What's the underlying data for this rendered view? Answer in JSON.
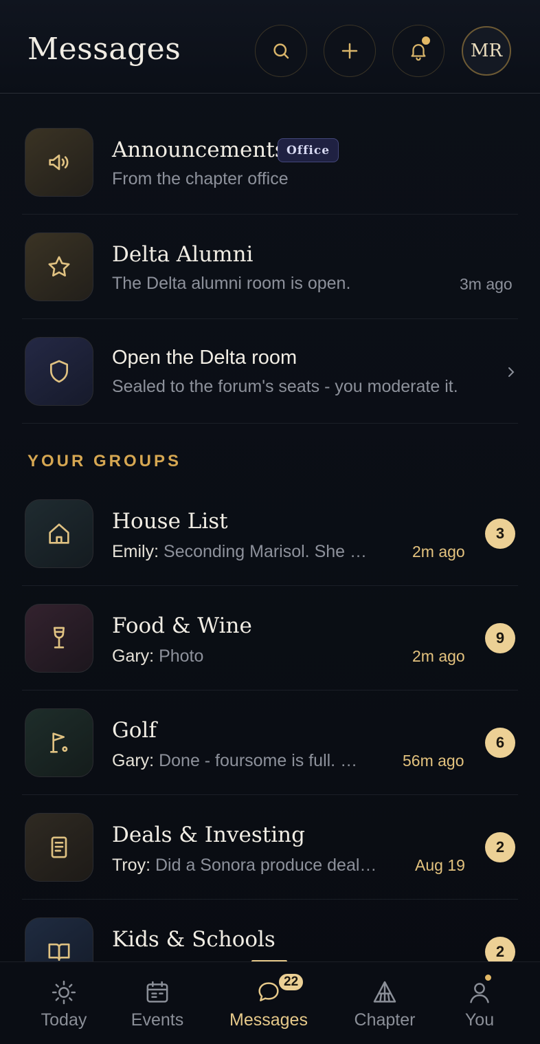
{
  "header": {
    "title": "Messages",
    "avatar_initials": "MR",
    "accent": "#e2b866"
  },
  "pinned": [
    {
      "title": "Announcements",
      "chip": "Office",
      "subtitle": "From the chapter office",
      "time": "",
      "icon": "megaphone-icon"
    },
    {
      "title": "Delta Alumni",
      "subtitle": "The Delta alumni room is open.",
      "time": "3m ago",
      "icon": "star-icon"
    },
    {
      "title": "Open the Delta room",
      "subtitle": "Sealed to the forum's seats - you moderate it.",
      "icon": "shield-icon"
    }
  ],
  "section_label": "YOUR GROUPS",
  "groups": [
    {
      "title": "House List",
      "sender": "Emily:",
      "preview": "Seconding Marisol. She …",
      "time": "2m ago",
      "unread": "3",
      "icon": "home-icon"
    },
    {
      "title": "Food & Wine",
      "sender": "Gary:",
      "preview": "Photo",
      "time": "2m ago",
      "unread": "9",
      "icon": "wine-glass-icon"
    },
    {
      "title": "Golf",
      "sender": "Gary:",
      "preview": "Done - foursome is full. …",
      "time": "56m ago",
      "unread": "6",
      "icon": "golf-flag-icon"
    },
    {
      "title": "Deals & Investing",
      "sender": "Troy:",
      "preview": "Did a Sonora produce deal…",
      "time": "Aug 19",
      "unread": "2",
      "icon": "document-icon"
    },
    {
      "title": "Kids & Schools",
      "sender": "",
      "preview": "",
      "time": "",
      "unread": "2",
      "icon": "book-icon"
    }
  ],
  "tabs": [
    {
      "label": "Today",
      "icon": "sun-icon"
    },
    {
      "label": "Events",
      "icon": "calendar-icon"
    },
    {
      "label": "Messages",
      "icon": "chat-bubble-icon",
      "badge": "22",
      "active": true
    },
    {
      "label": "Chapter",
      "icon": "temple-icon"
    },
    {
      "label": "You",
      "icon": "person-icon"
    }
  ]
}
